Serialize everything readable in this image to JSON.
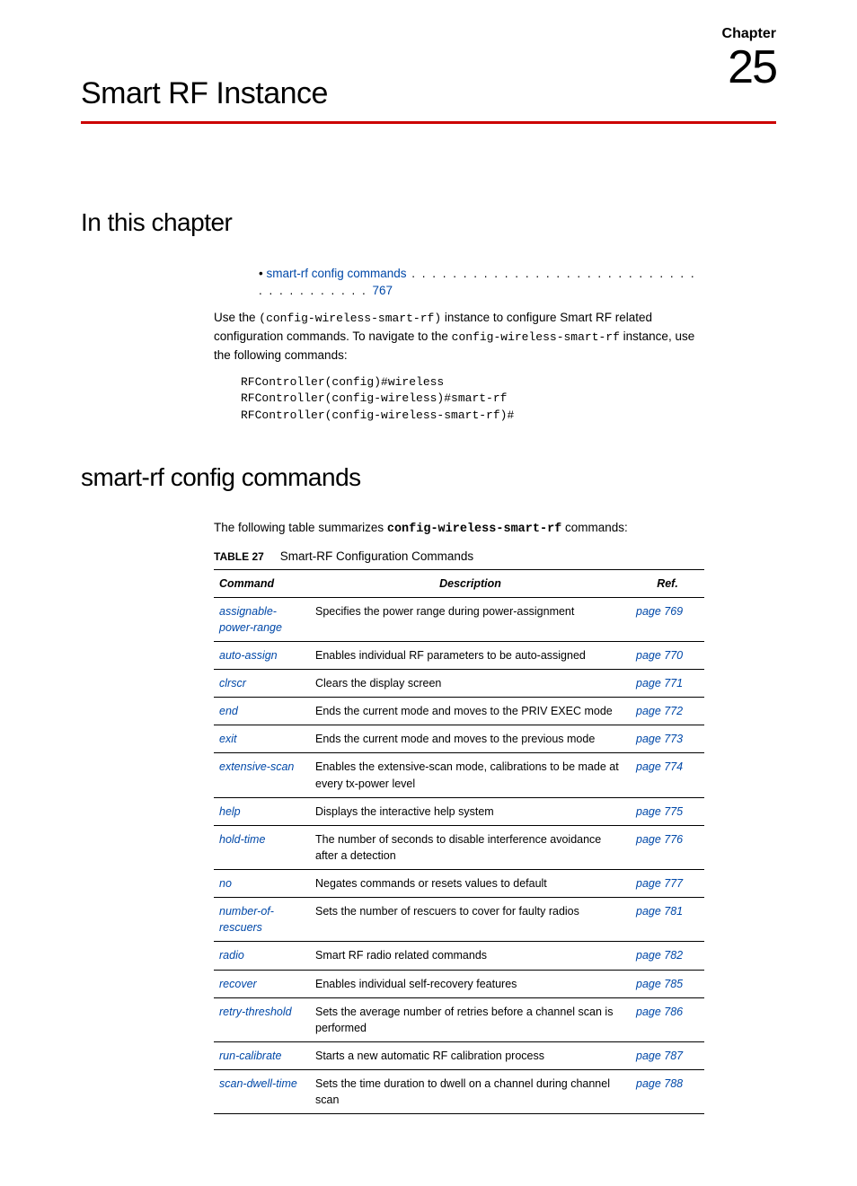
{
  "chapter": {
    "label": "Chapter",
    "number": "25",
    "title": "Smart RF Instance"
  },
  "section1": {
    "heading": "In this chapter",
    "toc": {
      "bullet": "•",
      "link_text": "smart-rf config commands",
      "dots": " . . . . . . . . . . . . . . . . . . . . . . . . . . . . . . . . . . . . . . .  ",
      "page": "767"
    },
    "intro": {
      "pre": "Use the ",
      "code1": "(config-wireless-smart-rf)",
      "mid1": " instance to configure Smart RF related configuration commands. To navigate to the ",
      "code2": "config-wireless-smart-rf",
      "mid2": " instance, use the following commands:"
    },
    "code_block": "RFController(config)#wireless\nRFController(config-wireless)#smart-rf\nRFController(config-wireless-smart-rf)#"
  },
  "section2": {
    "heading": "smart-rf config commands",
    "intro_pre": "The following table summarizes ",
    "intro_code": "config-wireless-smart-rf",
    "intro_post": " commands:",
    "table_label": "TABLE 27",
    "table_caption": "Smart-RF Configuration Commands",
    "headers": {
      "cmd": "Command",
      "desc": "Description",
      "ref": "Ref."
    },
    "rows": [
      {
        "cmd": "assignable-power-range",
        "desc": "Specifies the power range during power-assignment",
        "ref": "page 769"
      },
      {
        "cmd": "auto-assign",
        "desc": "Enables individual RF parameters to be auto-assigned",
        "ref": "page 770"
      },
      {
        "cmd": "clrscr",
        "desc": "Clears the display screen",
        "ref": "page 771"
      },
      {
        "cmd": "end",
        "desc": "Ends the current mode and moves to the PRIV EXEC mode",
        "ref": "page 772"
      },
      {
        "cmd": "exit",
        "desc": "Ends the current mode and moves to the previous mode",
        "ref": "page 773"
      },
      {
        "cmd": "extensive-scan",
        "desc": "Enables the extensive-scan mode, calibrations to be made at every tx-power level",
        "ref": "page 774"
      },
      {
        "cmd": "help",
        "desc": "Displays the interactive help system",
        "ref": "page 775"
      },
      {
        "cmd": "hold-time",
        "desc": "The number of seconds to disable interference avoidance after a detection",
        "ref": "page 776"
      },
      {
        "cmd": "no",
        "desc": "Negates commands or resets values to default",
        "ref": "page 777"
      },
      {
        "cmd": "number-of-rescuers",
        "desc": "Sets the number of rescuers to cover for faulty radios",
        "ref": "page 781"
      },
      {
        "cmd": "radio",
        "desc": "Smart RF radio related commands",
        "ref": "page 782"
      },
      {
        "cmd": "recover",
        "desc": "Enables individual self-recovery features",
        "ref": "page 785"
      },
      {
        "cmd": "retry-threshold",
        "desc": "Sets the average number of retries before a channel scan is performed",
        "ref": "page 786"
      },
      {
        "cmd": "run-calibrate",
        "desc": "Starts a new automatic RF calibration process",
        "ref": "page 787"
      },
      {
        "cmd": "scan-dwell-time",
        "desc": "Sets the time duration to dwell on a channel during channel scan",
        "ref": "page 788"
      }
    ]
  }
}
